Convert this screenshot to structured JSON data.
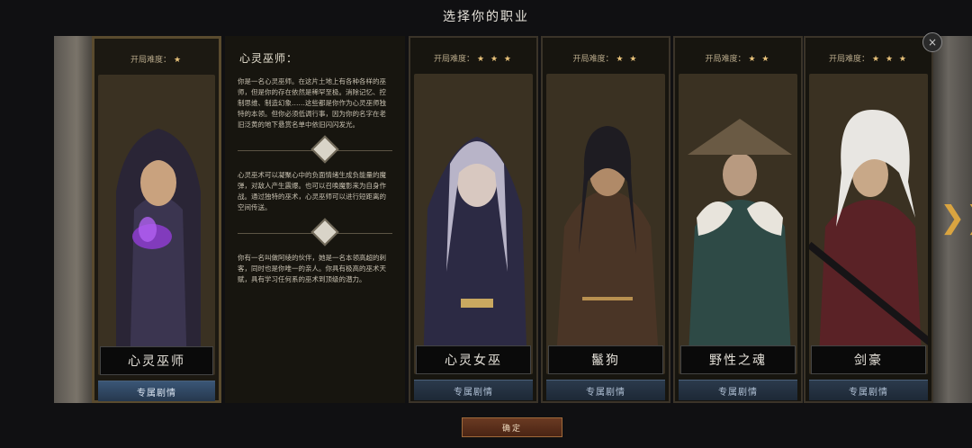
{
  "header": {
    "title": "选择你的职业"
  },
  "selected": {
    "difficulty_label": "开局难度：",
    "difficulty_stars": "★",
    "name": "心灵巫师",
    "story_label": "专属剧情"
  },
  "description": {
    "title": "心灵巫师：",
    "para1": "你是一名心灵巫师。在这片土地上有各种各样的巫师，但是你的存在依然是稀罕至极。消除记忆、控制思维、制造幻象……这些都是你作为心灵巫师独特的本领。但你必须低调行事，因为你的名字在老旧泛黄的地下悬赏名单中依旧闪闪发光。",
    "para2": "心灵巫术可以凝聚心中的负面情绪生成负能量的魔弹，对敌人产生震爆。也可以召唤魔影来为自身作战。通过独特的巫术，心灵巫师可以进行短距离的空间传送。",
    "para3": "你有一名叫做阿绫的伙伴，她是一名本领高超的刺客，同时也是你唯一的亲人。你具有极高的巫术天赋，具有学习任何系的巫术到顶级的潜力。"
  },
  "cards": [
    {
      "difficulty_label": "开局难度：",
      "stars": "★ ★ ★",
      "name": "心灵女巫",
      "story_label": "专属剧情"
    },
    {
      "difficulty_label": "开局难度：",
      "stars": "★ ★",
      "name": "鬣狗",
      "story_label": "专属剧情"
    },
    {
      "difficulty_label": "开局难度：",
      "stars": "★ ★",
      "name": "野性之魂",
      "story_label": "专属剧情"
    },
    {
      "difficulty_label": "开局难度：",
      "stars": "★ ★ ★",
      "name": "剑豪",
      "story_label": "专属剧情"
    }
  ],
  "controls": {
    "close_icon": "×",
    "next_icon": "❯❯",
    "confirm_label": "确定"
  },
  "colors": {
    "accent_gold": "#d9a440",
    "story_blue": "#2b3a4c",
    "confirm_red": "#6a3a22"
  }
}
